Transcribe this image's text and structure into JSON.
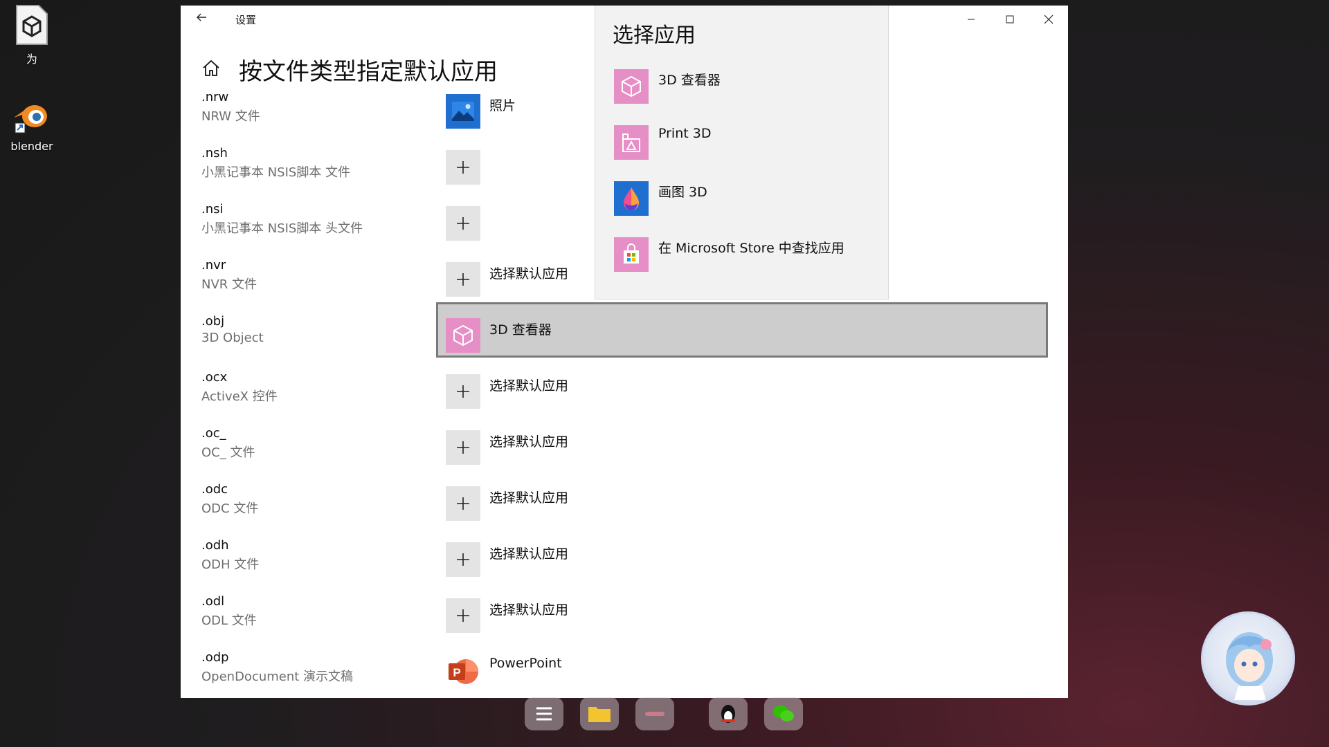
{
  "desktop": {
    "icons": [
      {
        "label": "为"
      },
      {
        "label": "blender"
      }
    ]
  },
  "window": {
    "title": "设置",
    "page_title": "按文件类型指定默认应用",
    "rows": [
      {
        "ext": ".nrw",
        "desc": "NRW 文件",
        "app": "照片",
        "icon": "photos-icon"
      },
      {
        "ext": ".nsh",
        "desc": "小黑记事本 NSIS脚本 文件",
        "app": "",
        "icon": "plus-icon"
      },
      {
        "ext": ".nsi",
        "desc": "小黑记事本 NSIS脚本 头文件",
        "app": "",
        "icon": "plus-icon"
      },
      {
        "ext": ".nvr",
        "desc": "NVR 文件",
        "app": "选择默认应用",
        "icon": "plus-icon"
      },
      {
        "ext": ".obj",
        "desc": "3D Object",
        "app": "3D 查看器",
        "icon": "3d-viewer-icon"
      },
      {
        "ext": ".ocx",
        "desc": "ActiveX 控件",
        "app": "选择默认应用",
        "icon": "plus-icon"
      },
      {
        "ext": ".oc_",
        "desc": "OC_ 文件",
        "app": "选择默认应用",
        "icon": "plus-icon"
      },
      {
        "ext": ".odc",
        "desc": "ODC 文件",
        "app": "选择默认应用",
        "icon": "plus-icon"
      },
      {
        "ext": ".odh",
        "desc": "ODH 文件",
        "app": "选择默认应用",
        "icon": "plus-icon"
      },
      {
        "ext": ".odl",
        "desc": "ODL 文件",
        "app": "选择默认应用",
        "icon": "plus-icon"
      },
      {
        "ext": ".odp",
        "desc": "OpenDocument 演示文稿",
        "app": "PowerPoint",
        "icon": "powerpoint-icon"
      }
    ]
  },
  "flyout": {
    "title": "选择应用",
    "items": [
      {
        "label": "3D 查看器",
        "icon": "3d-viewer-icon"
      },
      {
        "label": "Print 3D",
        "icon": "print-3d-icon"
      },
      {
        "label": "画图 3D",
        "icon": "paint-3d-icon"
      },
      {
        "label": "在 Microsoft Store 中查找应用",
        "icon": "store-icon"
      }
    ]
  },
  "colors": {
    "accent_pink": "#e58fc6",
    "photos_blue": "#1e6fd0",
    "powerpoint_orange": "#c9431f",
    "selected_row": "#cdcdcd"
  }
}
